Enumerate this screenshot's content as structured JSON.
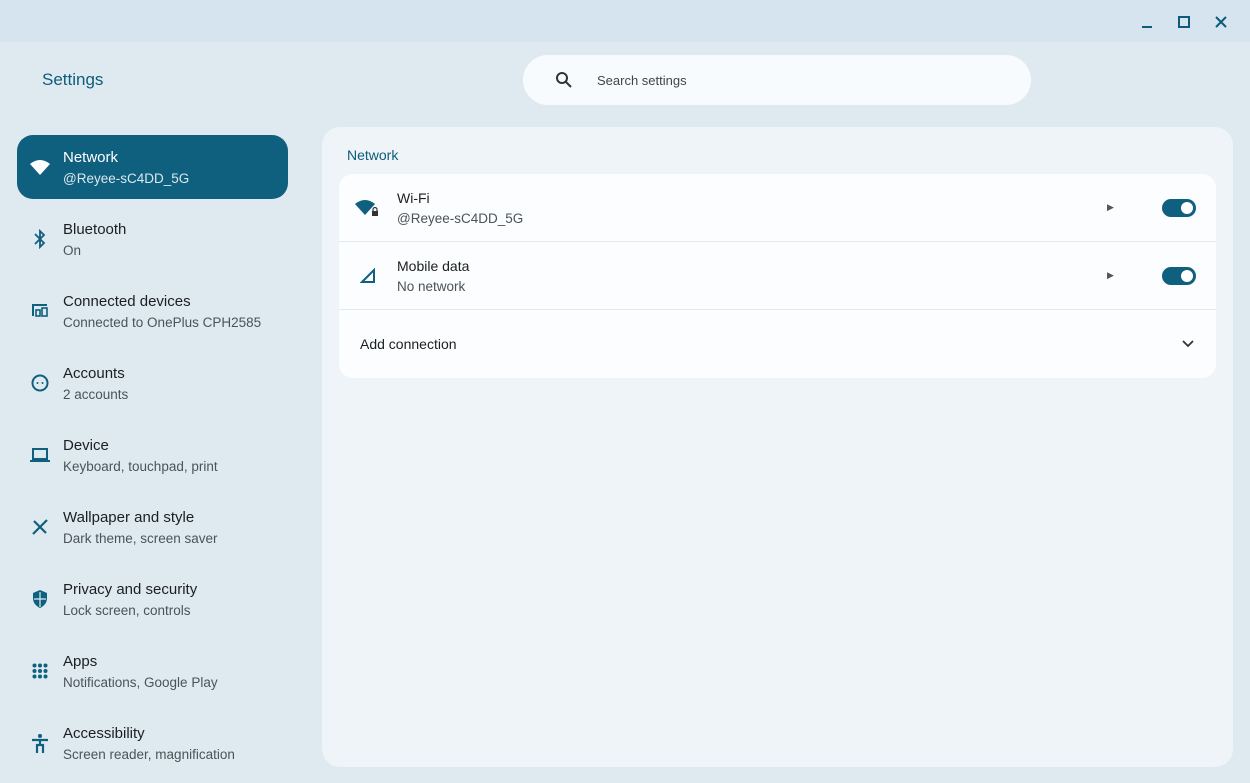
{
  "app_title": "Settings",
  "search": {
    "placeholder": "Search settings"
  },
  "window_controls": [
    "minimize",
    "maximize",
    "close"
  ],
  "nav": [
    {
      "label": "Network",
      "sub": "@Reyee-sC4DD_5G",
      "icon": "wifi-icon",
      "active": true
    },
    {
      "label": "Bluetooth",
      "sub": "On",
      "icon": "bluetooth-icon"
    },
    {
      "label": "Connected devices",
      "sub": "Connected to OnePlus CPH2585",
      "icon": "devices-icon"
    },
    {
      "label": "Accounts",
      "sub": "2 accounts",
      "icon": "account-icon"
    },
    {
      "label": "Device",
      "sub": "Keyboard, touchpad, print",
      "icon": "laptop-icon"
    },
    {
      "label": "Wallpaper and style",
      "sub": "Dark theme, screen saver",
      "icon": "palette-icon"
    },
    {
      "label": "Privacy and security",
      "sub": "Lock screen, controls",
      "icon": "shield-icon"
    },
    {
      "label": "Apps",
      "sub": "Notifications, Google Play",
      "icon": "apps-grid-icon"
    },
    {
      "label": "Accessibility",
      "sub": "Screen reader, magnification",
      "icon": "accessibility-icon"
    }
  ],
  "main": {
    "section_title": "Network",
    "rows": [
      {
        "label": "Wi-Fi",
        "sub": "@Reyee-sC4DD_5G",
        "toggle": true
      },
      {
        "label": "Mobile data",
        "sub": "No network",
        "toggle": true
      }
    ],
    "add_connection": "Add connection"
  },
  "colors": {
    "accent": "#0f5f7e",
    "background": "#dfeaf0"
  }
}
